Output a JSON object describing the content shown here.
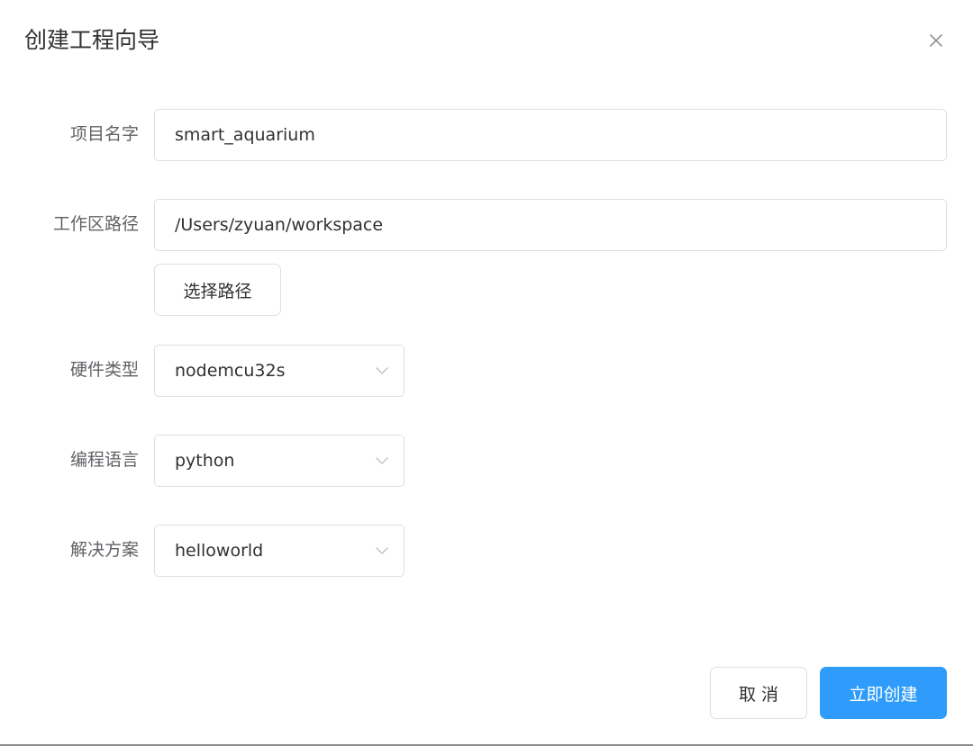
{
  "dialog": {
    "title": "创建工程向导"
  },
  "form": {
    "project_name": {
      "label": "项目名字",
      "value": "smart_aquarium"
    },
    "workspace_path": {
      "label": "工作区路径",
      "value": "/Users/zyuan/workspace",
      "choose_button": "选择路径"
    },
    "hardware_type": {
      "label": "硬件类型",
      "selected": "nodemcu32s"
    },
    "language": {
      "label": "编程语言",
      "selected": "python"
    },
    "solution": {
      "label": "解决方案",
      "selected": "helloworld"
    }
  },
  "footer": {
    "cancel_label": "取 消",
    "create_label": "立即创建"
  },
  "colors": {
    "primary": "#2f9bfb",
    "border": "#dcdfe6",
    "label": "#606266",
    "text": "#303133"
  },
  "icons": {
    "close": "close-icon",
    "dropdown": "chevron-down-icon"
  }
}
